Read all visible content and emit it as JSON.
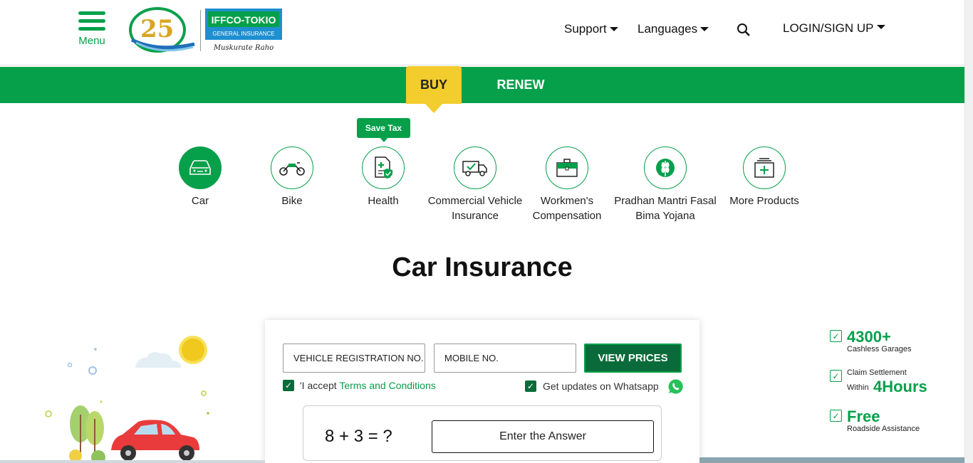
{
  "header": {
    "menu_label": "Menu",
    "logo_25_text": "25",
    "brand_name": "IFFCO-TOKIO",
    "brand_sub": "GENERAL INSURANCE",
    "brand_tagline": "Muskurate Raho",
    "nav": [
      {
        "label": "Support"
      },
      {
        "label": "Languages"
      },
      {
        "label": "LOGIN/SIGN UP"
      }
    ]
  },
  "tabs": {
    "buy": "BUY",
    "renew": "RENEW"
  },
  "badge": {
    "save_tax": "Save Tax"
  },
  "products": [
    {
      "label": "Car",
      "icon": "car-icon",
      "active": true
    },
    {
      "label": "Bike",
      "icon": "bike-icon"
    },
    {
      "label": "Health",
      "icon": "health-icon"
    },
    {
      "label": "Commercial Vehicle Insurance",
      "icon": "truck-icon"
    },
    {
      "label": "Workmen's Compensation",
      "icon": "briefcase-icon"
    },
    {
      "label": "Pradhan Mantri Fasal Bima Yojana",
      "icon": "crop-icon"
    },
    {
      "label": "More Products",
      "icon": "more-products-icon"
    }
  ],
  "main": {
    "title": "Car Insurance"
  },
  "form": {
    "vehicle_placeholder": "VEHICLE REGISTRATION NO.",
    "mobile_placeholder": "MOBILE NO.",
    "view_prices": "VIEW PRICES",
    "accept_prefix": "'I accept ",
    "terms_link": "Terms and Conditions",
    "whatsapp_text": "Get updates on Whatsapp",
    "captcha_question": "8 + 3 = ?",
    "captcha_placeholder": "Enter the Answer"
  },
  "features": [
    {
      "big": "4300+",
      "small": "Cashless Garages"
    },
    {
      "small_top": "Claim Settlement",
      "small_prefix": "Within",
      "big": "4Hours"
    },
    {
      "big": "Free",
      "small": "Roadside Assistance"
    }
  ],
  "colors": {
    "brand_green": "#06a04b",
    "dark_green": "#0a6b3a",
    "buy_yellow": "#f3cc2d"
  }
}
